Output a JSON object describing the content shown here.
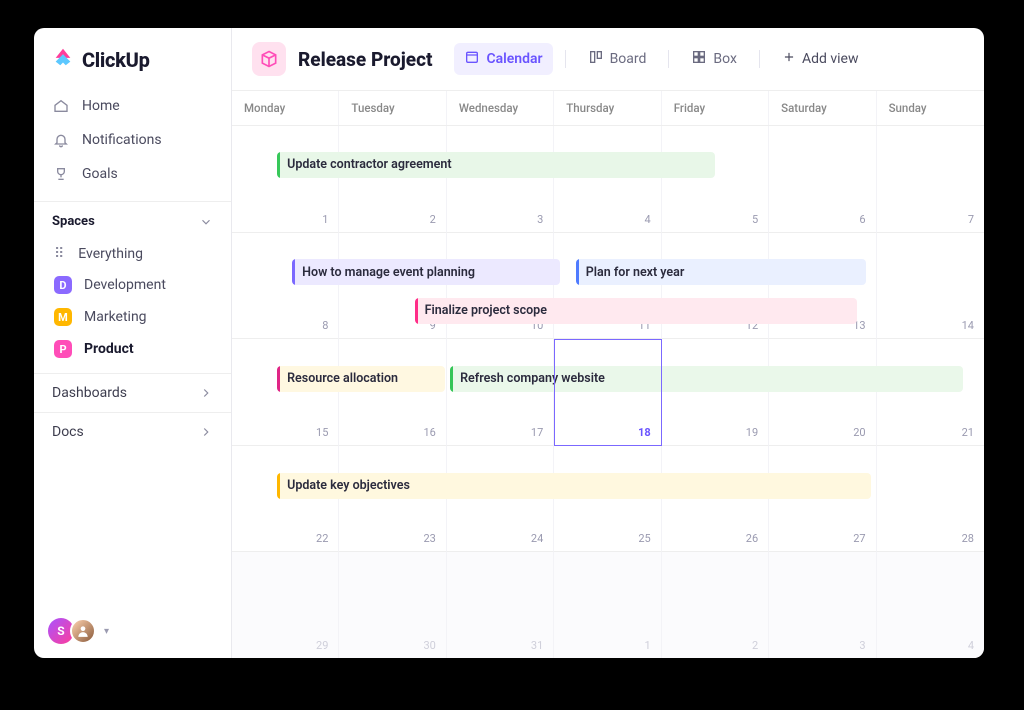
{
  "appName": "ClickUp",
  "nav": {
    "home": "Home",
    "notifications": "Notifications",
    "goals": "Goals"
  },
  "sections": {
    "spaces_label": "Spaces",
    "everything_label": "Everything",
    "dashboards_label": "Dashboards",
    "docs_label": "Docs"
  },
  "spaces": [
    {
      "letter": "D",
      "label": "Development",
      "color": "#8b6aff"
    },
    {
      "letter": "M",
      "label": "Marketing",
      "color": "#ffb700"
    },
    {
      "letter": "P",
      "label": "Product",
      "color": "#ff4db8",
      "active": true
    }
  ],
  "avatars": {
    "primary_letter": "S"
  },
  "project": {
    "title": "Release Project",
    "views": {
      "calendar": "Calendar",
      "board": "Board",
      "box": "Box",
      "add": "Add view"
    }
  },
  "calendar": {
    "days": [
      "Monday",
      "Tuesday",
      "Wednesday",
      "Thursday",
      "Friday",
      "Saturday",
      "Sunday"
    ],
    "weeks": [
      {
        "numbers": [
          "",
          "",
          "",
          "",
          "",
          "",
          ""
        ]
      },
      {
        "numbers": [
          "1",
          "2",
          "3",
          "4",
          "5",
          "6",
          "7"
        ]
      },
      {
        "numbers": [
          "8",
          "9",
          "10",
          "11",
          "12",
          "13",
          "14"
        ]
      },
      {
        "numbers": [
          "15",
          "16",
          "17",
          "18",
          "19",
          "20",
          "21"
        ],
        "today_index": 3
      },
      {
        "numbers": [
          "22",
          "23",
          "24",
          "25",
          "26",
          "27",
          "28"
        ]
      },
      {
        "numbers": [
          "29",
          "30",
          "31",
          "1",
          "2",
          "3",
          "4"
        ],
        "dim": true
      }
    ],
    "events": [
      {
        "title": "Update contractor agreement",
        "row": 0,
        "start": 0.42,
        "end": 4.5,
        "y": 0.25,
        "bg": "#e8f7e8",
        "bar": "#37c85a"
      },
      {
        "title": "How to manage event planning",
        "row": 1,
        "start": 0.56,
        "end": 3.05,
        "y": 0.26,
        "bg": "#ece9ff",
        "bar": "#7b68ff"
      },
      {
        "title": "Plan for next year",
        "row": 1,
        "start": 3.2,
        "end": 5.9,
        "y": 0.26,
        "bg": "#eaf0ff",
        "bar": "#4f7bff"
      },
      {
        "title": "Finalize project scope",
        "row": 1,
        "start": 1.7,
        "end": 5.82,
        "y": 0.62,
        "bg": "#ffe9ef",
        "bar": "#ff2d88"
      },
      {
        "title": "Resource allocation",
        "row": 2,
        "start": 0.42,
        "end": 1.98,
        "y": 0.26,
        "bg": "#fff8e1",
        "bar": "#e02586"
      },
      {
        "title": "Refresh company website",
        "row": 2,
        "start": 2.03,
        "end": 6.8,
        "y": 0.26,
        "bg": "#eaf8ea",
        "bar": "#35c558"
      },
      {
        "title": "Update key objectives",
        "row": 3,
        "start": 0.42,
        "end": 5.95,
        "y": 0.26,
        "bg": "#fff8df",
        "bar": "#ffb700"
      }
    ]
  }
}
